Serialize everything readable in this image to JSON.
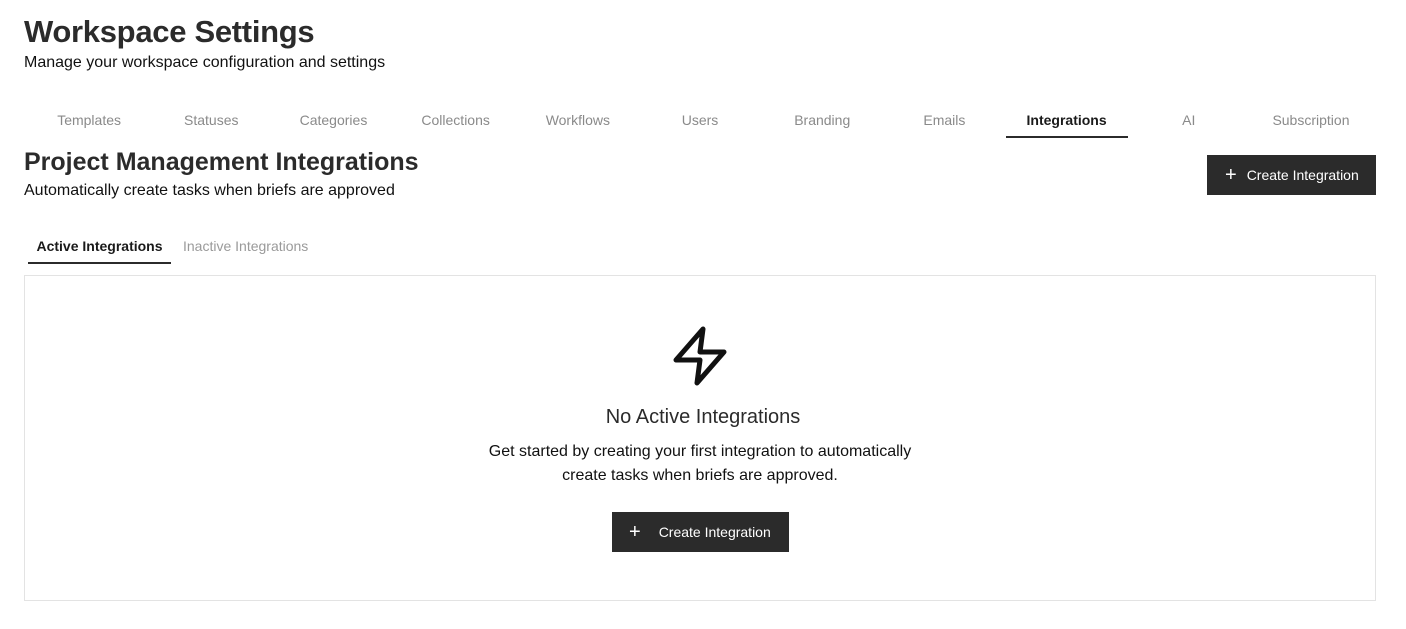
{
  "header": {
    "title": "Workspace Settings",
    "subtitle": "Manage your workspace configuration and settings"
  },
  "settings_tabs": [
    {
      "label": "Templates",
      "active": false
    },
    {
      "label": "Statuses",
      "active": false
    },
    {
      "label": "Categories",
      "active": false
    },
    {
      "label": "Collections",
      "active": false
    },
    {
      "label": "Workflows",
      "active": false
    },
    {
      "label": "Users",
      "active": false
    },
    {
      "label": "Branding",
      "active": false
    },
    {
      "label": "Emails",
      "active": false
    },
    {
      "label": "Integrations",
      "active": true
    },
    {
      "label": "AI",
      "active": false
    },
    {
      "label": "Subscription",
      "active": false
    }
  ],
  "section": {
    "title": "Project Management Integrations",
    "subtitle": "Automatically create tasks when briefs are approved",
    "create_button": {
      "icon": "plus-icon",
      "label": "Create Integration"
    }
  },
  "sub_tabs": [
    {
      "label": "Active Integrations",
      "active": true
    },
    {
      "label": "Inactive Integrations",
      "active": false
    }
  ],
  "empty_state": {
    "icon": "lightning-bolt-icon",
    "title": "No Active Integrations",
    "description": "Get started by creating your first integration to automatically create tasks when briefs are approved.",
    "button": {
      "icon": "plus-icon",
      "label": "Create Integration"
    }
  },
  "colors": {
    "primary_button": "#2b2b2b",
    "muted_text": "#8a8a8a",
    "border": "#e3e3e3"
  }
}
